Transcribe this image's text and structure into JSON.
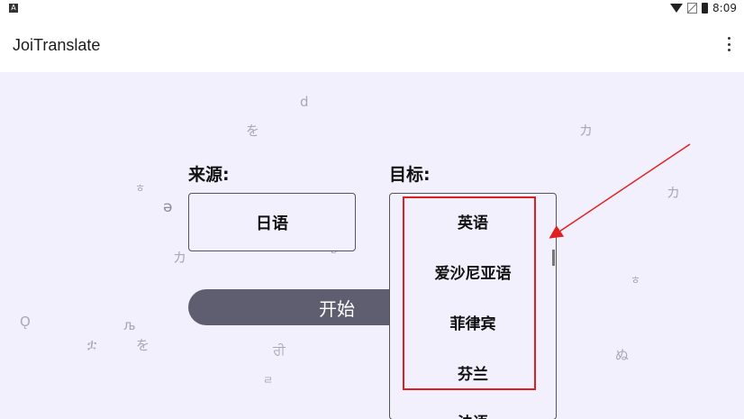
{
  "status_bar": {
    "notification_glyph": "A",
    "time": "8:09"
  },
  "app_bar": {
    "title": "JoiTranslate"
  },
  "form": {
    "source_label": "来源:",
    "target_label": "目标:",
    "source_value": "日语",
    "start_button": "开始"
  },
  "dropdown": {
    "options": [
      "英语",
      "爱沙尼亚语",
      "菲律宾",
      "芬兰",
      "法语"
    ]
  },
  "decorations": [
    "d",
    "を",
    "カ",
    "カ",
    "ㅎ",
    "ə",
    "カ",
    "ㅎ",
    "Ǫ",
    "љ",
    "ቷ",
    "を",
    "ਰੀ",
    "ㄹ",
    "ぬ",
    "ѣ"
  ],
  "colors": {
    "background": "#f1f0fc",
    "button": "#5f5e70",
    "annotation": "#e02020"
  }
}
